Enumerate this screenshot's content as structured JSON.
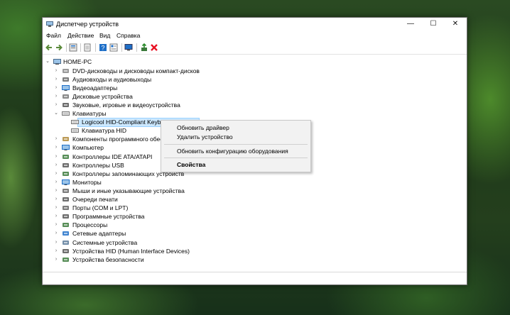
{
  "window": {
    "title": "Диспетчер устройств",
    "controls": {
      "minimize": "—",
      "maximize": "☐",
      "close": "✕"
    }
  },
  "menu": [
    "Файл",
    "Действие",
    "Вид",
    "Справка"
  ],
  "toolbar_icons": [
    "back-icon",
    "forward-icon",
    "properties-icon",
    "sheet-icon",
    "help-icon",
    "view-icon",
    "monitor-icon",
    "update-driver-icon",
    "uninstall-icon"
  ],
  "tree": {
    "root": "HOME-PC",
    "items": [
      {
        "label": "DVD-дисководы и дисководы компакт-дисков",
        "icon": "dvd-icon"
      },
      {
        "label": "Аудиовходы и аудиовыходы",
        "icon": "audio-icon"
      },
      {
        "label": "Видеоадаптеры",
        "icon": "display-adapter-icon"
      },
      {
        "label": "Дисковые устройства",
        "icon": "disk-icon"
      },
      {
        "label": "Звуковые, игровые и видеоустройства",
        "icon": "sound-icon"
      },
      {
        "label": "Клавиатуры",
        "icon": "keyboard-icon"
      },
      {
        "label": "Logicool HID-Compliant Keyboard (106 keys)",
        "icon": "keyboard-icon"
      },
      {
        "label": "Клавиатура HID",
        "icon": "keyboard-icon"
      },
      {
        "label": "Компоненты программного обеспечения",
        "icon": "software-icon"
      },
      {
        "label": "Компьютер",
        "icon": "computer-icon"
      },
      {
        "label": "Контроллеры IDE ATA/ATAPI",
        "icon": "ide-icon"
      },
      {
        "label": "Контроллеры USB",
        "icon": "usb-icon"
      },
      {
        "label": "Контроллеры запоминающих устройств",
        "icon": "storage-icon"
      },
      {
        "label": "Мониторы",
        "icon": "monitor-icon"
      },
      {
        "label": "Мыши и иные указывающие устройства",
        "icon": "mouse-icon"
      },
      {
        "label": "Очереди печати",
        "icon": "printer-icon"
      },
      {
        "label": "Порты (COM и LPT)",
        "icon": "port-icon"
      },
      {
        "label": "Программные устройства",
        "icon": "software-device-icon"
      },
      {
        "label": "Процессоры",
        "icon": "cpu-icon"
      },
      {
        "label": "Сетевые адаптеры",
        "icon": "network-icon"
      },
      {
        "label": "Системные устройства",
        "icon": "system-icon"
      },
      {
        "label": "Устройства HID (Human Interface Devices)",
        "icon": "hid-icon"
      },
      {
        "label": "Устройства безопасности",
        "icon": "security-icon"
      }
    ]
  },
  "context_menu": {
    "update_driver": "Обновить драйвер",
    "uninstall": "Удалить устройство",
    "scan": "Обновить конфигурацию оборудования",
    "properties": "Свойства"
  },
  "colors": {
    "selection": "#cce8ff",
    "accent_blue": "#1e6fc8",
    "uninstall_red": "#e81123"
  }
}
